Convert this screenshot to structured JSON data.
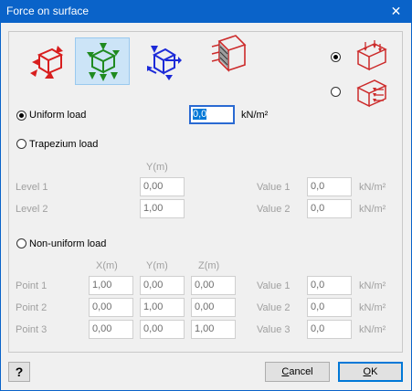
{
  "window": {
    "title": "Force on surface",
    "close_glyph": "✕"
  },
  "toolbar": {
    "icons": [
      {
        "name": "red-force-cube-icon",
        "color": "#d81e1e",
        "selected": false
      },
      {
        "name": "green-force-cube-icon",
        "color": "#1f8a1f",
        "selected": true
      },
      {
        "name": "blue-force-cube-icon",
        "color": "#1c2ad8",
        "selected": false
      },
      {
        "name": "face-load-cube-icon",
        "color": "#cc2a2a",
        "selected": false
      }
    ],
    "direction_options": [
      {
        "name": "surface-load-top-icon",
        "selected": true
      },
      {
        "name": "surface-load-side-icon",
        "selected": false
      }
    ]
  },
  "uniform": {
    "label": "Uniform load",
    "value": "0,0",
    "unit": "kN/m²"
  },
  "trapezium": {
    "label": "Trapezium load",
    "col_header": "Y(m)",
    "rows": [
      {
        "label": "Level 1",
        "y": "0,00",
        "value_label": "Value 1",
        "value": "0,0",
        "unit": "kN/m²"
      },
      {
        "label": "Level 2",
        "y": "1,00",
        "value_label": "Value 2",
        "value": "0,0",
        "unit": "kN/m²"
      }
    ]
  },
  "nonuniform": {
    "label": "Non-uniform load",
    "headers": [
      "X(m)",
      "Y(m)",
      "Z(m)"
    ],
    "rows": [
      {
        "label": "Point 1",
        "x": "1,00",
        "y": "0,00",
        "z": "0,00",
        "value_label": "Value 1",
        "value": "0,0",
        "unit": "kN/m²"
      },
      {
        "label": "Point 2",
        "x": "0,00",
        "y": "1,00",
        "z": "0,00",
        "value_label": "Value 2",
        "value": "0,0",
        "unit": "kN/m²"
      },
      {
        "label": "Point 3",
        "x": "0,00",
        "y": "0,00",
        "z": "1,00",
        "value_label": "Value 3",
        "value": "0,0",
        "unit": "kN/m²"
      }
    ]
  },
  "buttons": {
    "help": "?",
    "cancel": "Cancel",
    "ok": "OK"
  }
}
